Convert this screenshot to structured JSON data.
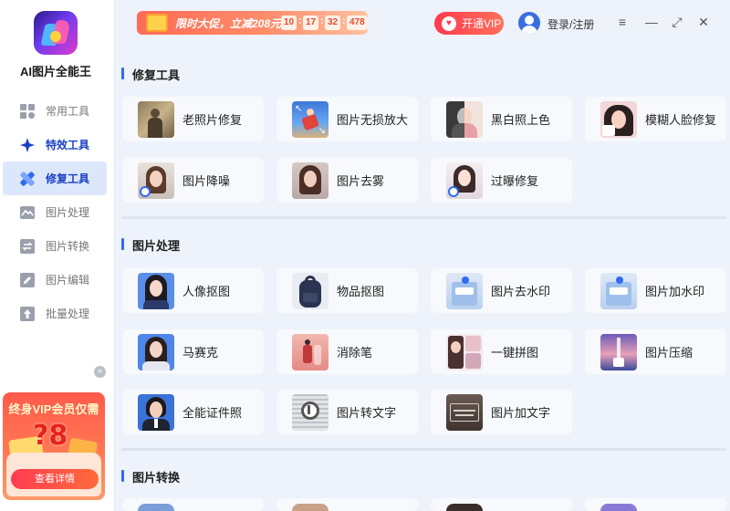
{
  "app": {
    "name": "AI图片全能王"
  },
  "sidebar": {
    "items": [
      {
        "label": "常用工具",
        "icon": "grid-icon"
      },
      {
        "label": "特效工具",
        "icon": "sparkle-icon"
      },
      {
        "label": "修复工具",
        "icon": "repair-icon"
      },
      {
        "label": "图片处理",
        "icon": "image-process-icon"
      },
      {
        "label": "图片转换",
        "icon": "convert-icon"
      },
      {
        "label": "图片编辑",
        "icon": "edit-icon"
      },
      {
        "label": "批量处理",
        "icon": "batch-upload-icon"
      }
    ],
    "active_index": 2
  },
  "ad": {
    "title": "终身VIP会员仅需",
    "price": "?8",
    "button": "查看详情",
    "close": "×"
  },
  "promo": {
    "text": "限时大促，立减208元",
    "countdown": [
      "10",
      "17",
      "32",
      "478"
    ],
    "separators": [
      ":",
      ":",
      ":"
    ]
  },
  "header": {
    "vip_button": "开通VIP",
    "login": "登录/注册",
    "menu_icon": "≡",
    "minimize_icon": "—",
    "maximize_icon": "⤢",
    "close_icon": "✕"
  },
  "sections": [
    {
      "title": "修复工具",
      "cards": [
        {
          "label": "老照片修复",
          "icon": "old-photo-thumb"
        },
        {
          "label": "图片无损放大",
          "icon": "upscale-thumb"
        },
        {
          "label": "黑白照上色",
          "icon": "colorize-thumb"
        },
        {
          "label": "模糊人脸修复",
          "icon": "face-repair-thumb"
        },
        {
          "label": "图片降噪",
          "icon": "denoise-thumb"
        },
        {
          "label": "图片去雾",
          "icon": "dehaze-thumb"
        },
        {
          "label": "过曝修复",
          "icon": "overexposure-thumb"
        }
      ]
    },
    {
      "title": "图片处理",
      "cards": [
        {
          "label": "人像抠图",
          "icon": "portrait-cutout-thumb"
        },
        {
          "label": "物品抠图",
          "icon": "object-cutout-thumb"
        },
        {
          "label": "图片去水印",
          "icon": "remove-watermark-thumb"
        },
        {
          "label": "图片加水印",
          "icon": "add-watermark-thumb"
        },
        {
          "label": "马赛克",
          "icon": "mosaic-thumb"
        },
        {
          "label": "消除笔",
          "icon": "eraser-thumb"
        },
        {
          "label": "一键拼图",
          "icon": "collage-thumb"
        },
        {
          "label": "图片压缩",
          "icon": "compress-thumb"
        },
        {
          "label": "全能证件照",
          "icon": "id-photo-thumb"
        },
        {
          "label": "图片转文字",
          "icon": "ocr-thumb"
        },
        {
          "label": "图片加文字",
          "icon": "add-text-thumb"
        }
      ]
    },
    {
      "title": "图片转换",
      "cards": []
    }
  ]
}
